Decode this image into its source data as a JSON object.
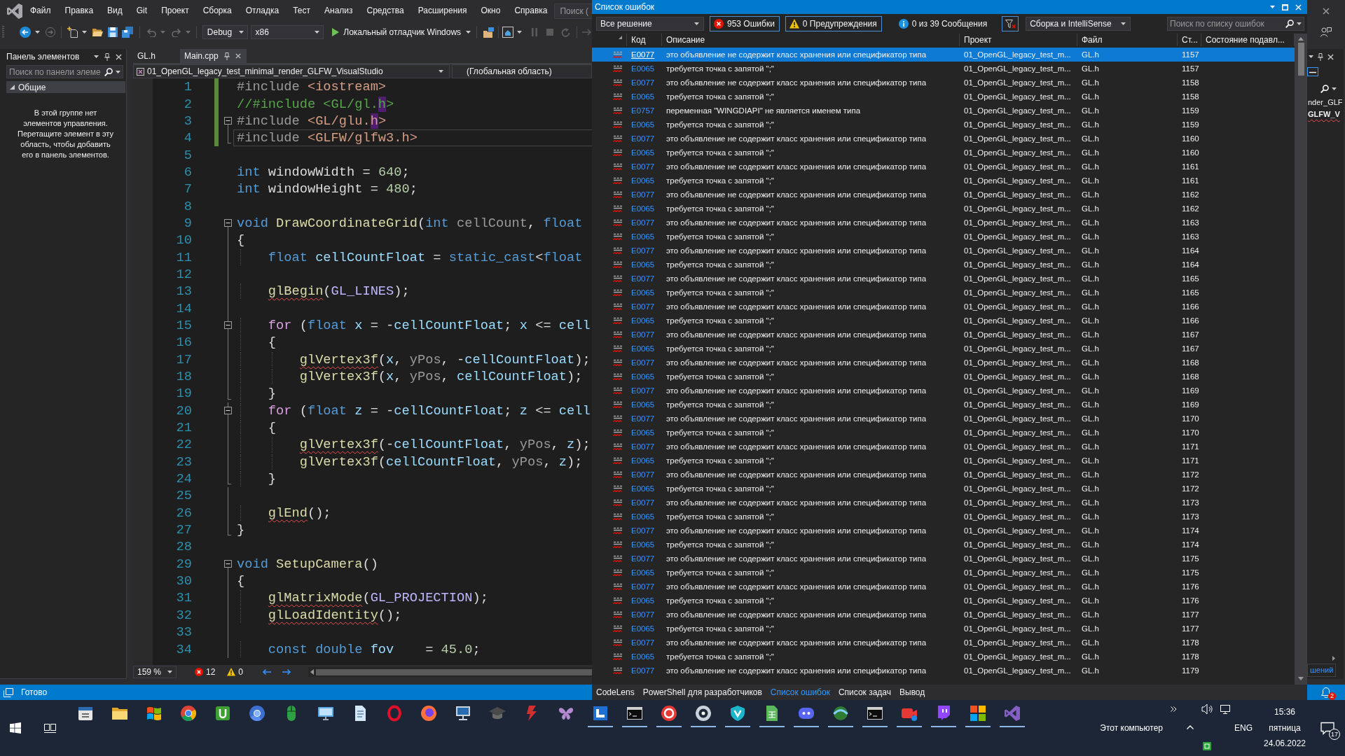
{
  "menu_bar": {
    "items": [
      "Файл",
      "Правка",
      "Вид",
      "Git",
      "Проект",
      "Сборка",
      "Отладка",
      "Тест",
      "Анализ",
      "Средства",
      "Расширения",
      "Окно",
      "Справка"
    ],
    "search": {
      "placeholder": "Поиск ("
    }
  },
  "toolbar": {
    "configuration": "Debug",
    "platform": "x86",
    "start_button": "Локальный отладчик Windows"
  },
  "toolbox": {
    "title": "Панель элементов",
    "search": {
      "placeholder": "Поиск по панели элеме"
    },
    "group": {
      "label": "Общие",
      "expanded": true
    },
    "empty_message": "В этой группе нет элементов управления. Перетащите элемент в эту область, чтобы добавить его в панель элементов."
  },
  "editor": {
    "tabs": [
      {
        "label": "GL.h",
        "selected": false
      },
      {
        "label": "Main.cpp",
        "selected": true
      }
    ],
    "project": "01_OpenGL_legacy_test_minimal_render_GLFW_VisualStudio",
    "scope": "(Глобальная область)",
    "lines": [
      {
        "number": "1",
        "kind": "plain",
        "changed": true,
        "current": false,
        "tokens": [
          {
            "text": "#include ",
            "kind": "pre"
          },
          {
            "text": "<iostream>",
            "kind": "inc"
          }
        ]
      },
      {
        "number": "2",
        "kind": "plain",
        "changed": true,
        "current": false,
        "tokens": [
          {
            "text": "//#include <GL/gl.",
            "kind": "comment"
          },
          {
            "text": "h",
            "kind": "comment_match"
          },
          {
            "text": ">",
            "kind": "comment"
          }
        ]
      },
      {
        "number": "3",
        "kind": "fold_start",
        "changed": true,
        "current": false,
        "tokens": [
          {
            "text": "#include ",
            "kind": "pre"
          },
          {
            "text": "<GL/glu.",
            "kind": "inc"
          },
          {
            "text": "h",
            "kind": "inc_match"
          },
          {
            "text": ">",
            "kind": "inc"
          }
        ]
      },
      {
        "number": "4",
        "kind": "fold_end",
        "changed": true,
        "current": true,
        "tokens": [
          {
            "text": "#include ",
            "kind": "pre"
          },
          {
            "text": "<GLFW/glfw3.h>",
            "kind": "inc"
          }
        ]
      },
      {
        "number": "5",
        "kind": "plain",
        "changed": false,
        "current": false
      },
      {
        "number": "6",
        "kind": "plain",
        "changed": false,
        "current": false,
        "tokens": [
          {
            "text": "int ",
            "kind": "kw"
          },
          {
            "text": "windowWidth = ",
            "kind": "plain"
          },
          {
            "text": "640",
            "kind": "num"
          },
          {
            "text": ";",
            "kind": "plain"
          }
        ]
      },
      {
        "number": "7",
        "kind": "plain",
        "changed": false,
        "current": false,
        "tokens": [
          {
            "text": "int ",
            "kind": "kw"
          },
          {
            "text": "windowHeight = ",
            "kind": "plain"
          },
          {
            "text": "480",
            "kind": "num"
          },
          {
            "text": ";",
            "kind": "plain"
          }
        ]
      },
      {
        "number": "8",
        "kind": "plain",
        "changed": false,
        "current": false
      },
      {
        "number": "9",
        "kind": "fold_start",
        "changed": false,
        "current": false,
        "tokens": [
          {
            "text": "void ",
            "kind": "kw"
          },
          {
            "text": "DrawCoordinateGrid",
            "kind": "fn"
          },
          {
            "text": "(",
            "kind": "plain"
          },
          {
            "text": "int ",
            "kind": "kw"
          },
          {
            "text": "cellCount",
            "kind": "param"
          },
          {
            "text": ", ",
            "kind": "plain"
          },
          {
            "text": "float",
            "kind": "kw"
          }
        ]
      },
      {
        "number": "10",
        "kind": "fold_body",
        "changed": false,
        "current": false,
        "tokens": [
          {
            "text": "{",
            "kind": "plain"
          }
        ]
      },
      {
        "number": "11",
        "kind": "fold_body",
        "changed": false,
        "current": false,
        "tokens": [
          {
            "text": "    float ",
            "kind": "kw"
          },
          {
            "text": "cellCountFloat",
            "kind": "var"
          },
          {
            "text": " = ",
            "kind": "plain"
          },
          {
            "text": "static_cast",
            "kind": "kw"
          },
          {
            "text": "<",
            "kind": "plain"
          },
          {
            "text": "float",
            "kind": "kw"
          }
        ]
      },
      {
        "number": "12",
        "kind": "fold_body",
        "changed": false,
        "current": false
      },
      {
        "number": "13",
        "kind": "fold_body",
        "changed": false,
        "current": false,
        "tokens": [
          {
            "text": "    glBegin",
            "kind": "fn_error"
          },
          {
            "text": "(",
            "kind": "plain"
          },
          {
            "text": "GL_LINES",
            "kind": "macro"
          },
          {
            "text": ");",
            "kind": "plain"
          }
        ]
      },
      {
        "number": "14",
        "kind": "fold_body",
        "changed": false,
        "current": false
      },
      {
        "number": "15",
        "kind": "fold_nested_start",
        "changed": false,
        "current": false,
        "tokens": [
          {
            "text": "    for",
            "kind": "ctrl"
          },
          {
            "text": " (",
            "kind": "plain"
          },
          {
            "text": "float ",
            "kind": "kw"
          },
          {
            "text": "x",
            "kind": "var"
          },
          {
            "text": " = -",
            "kind": "plain"
          },
          {
            "text": "cellCountFloat",
            "kind": "var"
          },
          {
            "text": "; ",
            "kind": "plain"
          },
          {
            "text": "x",
            "kind": "var"
          },
          {
            "text": " <= ",
            "kind": "plain"
          },
          {
            "text": "cell",
            "kind": "var"
          }
        ]
      },
      {
        "number": "16",
        "kind": "fold_body",
        "changed": false,
        "current": false,
        "tokens": [
          {
            "text": "    {",
            "kind": "plain"
          }
        ]
      },
      {
        "number": "17",
        "kind": "fold_body",
        "changed": false,
        "current": false,
        "tokens": [
          {
            "text": "        glVertex3f",
            "kind": "fn_error"
          },
          {
            "text": "(",
            "kind": "plain"
          },
          {
            "text": "x",
            "kind": "var"
          },
          {
            "text": ", ",
            "kind": "plain"
          },
          {
            "text": "yPos",
            "kind": "param"
          },
          {
            "text": ", -",
            "kind": "plain"
          },
          {
            "text": "cellCountFloat",
            "kind": "var"
          },
          {
            "text": ");",
            "kind": "plain"
          }
        ]
      },
      {
        "number": "18",
        "kind": "fold_body",
        "changed": false,
        "current": false,
        "tokens": [
          {
            "text": "        glVertex3f",
            "kind": "fn"
          },
          {
            "text": "(",
            "kind": "plain"
          },
          {
            "text": "x",
            "kind": "var"
          },
          {
            "text": ", ",
            "kind": "plain"
          },
          {
            "text": "yPos",
            "kind": "param"
          },
          {
            "text": ", ",
            "kind": "plain"
          },
          {
            "text": "cellCountFloat",
            "kind": "var"
          },
          {
            "text": ");",
            "kind": "plain"
          }
        ]
      },
      {
        "number": "19",
        "kind": "fold_end",
        "changed": false,
        "current": false,
        "tokens": [
          {
            "text": "    }",
            "kind": "plain"
          }
        ]
      },
      {
        "number": "20",
        "kind": "fold_nested_start",
        "changed": false,
        "current": false,
        "tokens": [
          {
            "text": "    for",
            "kind": "ctrl"
          },
          {
            "text": " (",
            "kind": "plain"
          },
          {
            "text": "float ",
            "kind": "kw"
          },
          {
            "text": "z",
            "kind": "var"
          },
          {
            "text": " = -",
            "kind": "plain"
          },
          {
            "text": "cellCountFloat",
            "kind": "var"
          },
          {
            "text": "; ",
            "kind": "plain"
          },
          {
            "text": "z",
            "kind": "var"
          },
          {
            "text": " <= ",
            "kind": "plain"
          },
          {
            "text": "cell",
            "kind": "var"
          }
        ]
      },
      {
        "number": "21",
        "kind": "fold_body",
        "changed": false,
        "current": false,
        "tokens": [
          {
            "text": "    {",
            "kind": "plain"
          }
        ]
      },
      {
        "number": "22",
        "kind": "fold_body",
        "changed": false,
        "current": false,
        "tokens": [
          {
            "text": "        glVertex3f",
            "kind": "fn_error"
          },
          {
            "text": "(-",
            "kind": "plain"
          },
          {
            "text": "cellCountFloat",
            "kind": "var"
          },
          {
            "text": ", ",
            "kind": "plain"
          },
          {
            "text": "yPos",
            "kind": "param"
          },
          {
            "text": ", ",
            "kind": "plain"
          },
          {
            "text": "z",
            "kind": "var"
          },
          {
            "text": ");",
            "kind": "plain"
          }
        ]
      },
      {
        "number": "23",
        "kind": "fold_body",
        "changed": false,
        "current": false,
        "tokens": [
          {
            "text": "        glVertex3f",
            "kind": "fn"
          },
          {
            "text": "(",
            "kind": "plain"
          },
          {
            "text": "cellCountFloat",
            "kind": "var"
          },
          {
            "text": ", ",
            "kind": "plain"
          },
          {
            "text": "yPos",
            "kind": "param"
          },
          {
            "text": ", ",
            "kind": "plain"
          },
          {
            "text": "z",
            "kind": "var"
          },
          {
            "text": ");",
            "kind": "plain"
          }
        ]
      },
      {
        "number": "24",
        "kind": "fold_end",
        "changed": false,
        "current": false,
        "tokens": [
          {
            "text": "    }",
            "kind": "plain"
          }
        ]
      },
      {
        "number": "25",
        "kind": "fold_body",
        "changed": false,
        "current": false
      },
      {
        "number": "26",
        "kind": "fold_body",
        "changed": false,
        "current": false,
        "tokens": [
          {
            "text": "    glEnd",
            "kind": "fn_error"
          },
          {
            "text": "();",
            "kind": "plain"
          }
        ]
      },
      {
        "number": "27",
        "kind": "fold_end",
        "changed": false,
        "current": false,
        "tokens": [
          {
            "text": "}",
            "kind": "plain"
          }
        ]
      },
      {
        "number": "28",
        "kind": "plain",
        "changed": false,
        "current": false
      },
      {
        "number": "29",
        "kind": "fold_start",
        "changed": false,
        "current": false,
        "tokens": [
          {
            "text": "void ",
            "kind": "kw"
          },
          {
            "text": "SetupCamera",
            "kind": "fn"
          },
          {
            "text": "()",
            "kind": "plain"
          }
        ]
      },
      {
        "number": "30",
        "kind": "fold_body",
        "changed": false,
        "current": false,
        "tokens": [
          {
            "text": "{",
            "kind": "plain"
          }
        ]
      },
      {
        "number": "31",
        "kind": "fold_body",
        "changed": false,
        "current": false,
        "tokens": [
          {
            "text": "    glMatrixMode",
            "kind": "fn_error"
          },
          {
            "text": "(",
            "kind": "plain"
          },
          {
            "text": "GL_PROJECTION",
            "kind": "macro"
          },
          {
            "text": ");",
            "kind": "plain"
          }
        ]
      },
      {
        "number": "32",
        "kind": "fold_body",
        "changed": false,
        "current": false,
        "tokens": [
          {
            "text": "    glLoadIdentity",
            "kind": "fn_error"
          },
          {
            "text": "();",
            "kind": "plain"
          }
        ]
      },
      {
        "number": "33",
        "kind": "fold_body",
        "changed": false,
        "current": false
      },
      {
        "number": "34",
        "kind": "fold_body",
        "changed": false,
        "current": false,
        "tokens": [
          {
            "text": "    const ",
            "kind": "kw"
          },
          {
            "text": "double ",
            "kind": "kw"
          },
          {
            "text": "fov",
            "kind": "var"
          },
          {
            "text": "    = ",
            "kind": "plain"
          },
          {
            "text": "45.0",
            "kind": "num"
          },
          {
            "text": ";",
            "kind": "plain"
          }
        ]
      }
    ],
    "zoom": "159 %",
    "errors": "12",
    "warnings": "0"
  },
  "status_bar": {
    "text": "Готово"
  },
  "error_list": {
    "title": "Список ошибок",
    "scope": "Все решение",
    "filters": [
      {
        "kind": "error",
        "label": "953 Ошибки",
        "selected": true
      },
      {
        "kind": "warning",
        "label": "0 Предупреждения",
        "selected": true
      },
      {
        "kind": "info",
        "label": "0 из 39 Сообщения",
        "selected": false
      }
    ],
    "filter_button": {
      "selected": true
    },
    "source": "Сборка и IntelliSense",
    "search": {
      "placeholder": "Поиск по списку ошибок"
    },
    "columns": [
      "Код",
      "Описание",
      "Проект",
      "Файл",
      "Ст...",
      "Состояние подавл..."
    ],
    "rows": [
      {
        "code": "E0077",
        "description": "это объявление не содержит класс хранения или спецификатор типа",
        "project": "01_OpenGL_legacy_test_m...",
        "file": "GL.h",
        "line": "1157",
        "selected": true
      },
      {
        "code": "E0065",
        "description": "требуется точка с запятой \";\"",
        "project": "01_OpenGL_legacy_test_m...",
        "file": "GL.h",
        "line": "1157",
        "selected": false
      },
      {
        "code": "E0077",
        "description": "это объявление не содержит класс хранения или спецификатор типа",
        "project": "01_OpenGL_legacy_test_m...",
        "file": "GL.h",
        "line": "1158",
        "selected": false
      },
      {
        "code": "E0065",
        "description": "требуется точка с запятой \";\"",
        "project": "01_OpenGL_legacy_test_m...",
        "file": "GL.h",
        "line": "1158",
        "selected": false
      },
      {
        "code": "E0757",
        "description": "переменная \"WINGDIAPI\" не является именем типа",
        "project": "01_OpenGL_legacy_test_m...",
        "file": "GL.h",
        "line": "1159",
        "selected": false
      },
      {
        "code": "E0065",
        "description": "требуется точка с запятой \";\"",
        "project": "01_OpenGL_legacy_test_m...",
        "file": "GL.h",
        "line": "1159",
        "selected": false
      },
      {
        "code": "E0077",
        "description": "это объявление не содержит класс хранения или спецификатор типа",
        "project": "01_OpenGL_legacy_test_m...",
        "file": "GL.h",
        "line": "1160",
        "selected": false
      },
      {
        "code": "E0065",
        "description": "требуется точка с запятой \";\"",
        "project": "01_OpenGL_legacy_test_m...",
        "file": "GL.h",
        "line": "1160",
        "selected": false
      },
      {
        "code": "E0077",
        "description": "это объявление не содержит класс хранения или спецификатор типа",
        "project": "01_OpenGL_legacy_test_m...",
        "file": "GL.h",
        "line": "1161",
        "selected": false
      },
      {
        "code": "E0065",
        "description": "требуется точка с запятой \";\"",
        "project": "01_OpenGL_legacy_test_m...",
        "file": "GL.h",
        "line": "1161",
        "selected": false
      },
      {
        "code": "E0077",
        "description": "это объявление не содержит класс хранения или спецификатор типа",
        "project": "01_OpenGL_legacy_test_m...",
        "file": "GL.h",
        "line": "1162",
        "selected": false
      },
      {
        "code": "E0065",
        "description": "требуется точка с запятой \";\"",
        "project": "01_OpenGL_legacy_test_m...",
        "file": "GL.h",
        "line": "1162",
        "selected": false
      },
      {
        "code": "E0077",
        "description": "это объявление не содержит класс хранения или спецификатор типа",
        "project": "01_OpenGL_legacy_test_m...",
        "file": "GL.h",
        "line": "1163",
        "selected": false
      },
      {
        "code": "E0065",
        "description": "требуется точка с запятой \";\"",
        "project": "01_OpenGL_legacy_test_m...",
        "file": "GL.h",
        "line": "1163",
        "selected": false
      },
      {
        "code": "E0077",
        "description": "это объявление не содержит класс хранения или спецификатор типа",
        "project": "01_OpenGL_legacy_test_m...",
        "file": "GL.h",
        "line": "1164",
        "selected": false
      },
      {
        "code": "E0065",
        "description": "требуется точка с запятой \";\"",
        "project": "01_OpenGL_legacy_test_m...",
        "file": "GL.h",
        "line": "1164",
        "selected": false
      },
      {
        "code": "E0077",
        "description": "это объявление не содержит класс хранения или спецификатор типа",
        "project": "01_OpenGL_legacy_test_m...",
        "file": "GL.h",
        "line": "1165",
        "selected": false
      },
      {
        "code": "E0065",
        "description": "требуется точка с запятой \";\"",
        "project": "01_OpenGL_legacy_test_m...",
        "file": "GL.h",
        "line": "1165",
        "selected": false
      },
      {
        "code": "E0077",
        "description": "это объявление не содержит класс хранения или спецификатор типа",
        "project": "01_OpenGL_legacy_test_m...",
        "file": "GL.h",
        "line": "1166",
        "selected": false
      },
      {
        "code": "E0065",
        "description": "требуется точка с запятой \";\"",
        "project": "01_OpenGL_legacy_test_m...",
        "file": "GL.h",
        "line": "1166",
        "selected": false
      },
      {
        "code": "E0077",
        "description": "это объявление не содержит класс хранения или спецификатор типа",
        "project": "01_OpenGL_legacy_test_m...",
        "file": "GL.h",
        "line": "1167",
        "selected": false
      },
      {
        "code": "E0065",
        "description": "требуется точка с запятой \";\"",
        "project": "01_OpenGL_legacy_test_m...",
        "file": "GL.h",
        "line": "1167",
        "selected": false
      },
      {
        "code": "E0077",
        "description": "это объявление не содержит класс хранения или спецификатор типа",
        "project": "01_OpenGL_legacy_test_m...",
        "file": "GL.h",
        "line": "1168",
        "selected": false
      },
      {
        "code": "E0065",
        "description": "требуется точка с запятой \";\"",
        "project": "01_OpenGL_legacy_test_m...",
        "file": "GL.h",
        "line": "1168",
        "selected": false
      },
      {
        "code": "E0077",
        "description": "это объявление не содержит класс хранения или спецификатор типа",
        "project": "01_OpenGL_legacy_test_m...",
        "file": "GL.h",
        "line": "1169",
        "selected": false
      },
      {
        "code": "E0065",
        "description": "требуется точка с запятой \";\"",
        "project": "01_OpenGL_legacy_test_m...",
        "file": "GL.h",
        "line": "1169",
        "selected": false
      },
      {
        "code": "E0077",
        "description": "это объявление не содержит класс хранения или спецификатор типа",
        "project": "01_OpenGL_legacy_test_m...",
        "file": "GL.h",
        "line": "1170",
        "selected": false
      },
      {
        "code": "E0065",
        "description": "требуется точка с запятой \";\"",
        "project": "01_OpenGL_legacy_test_m...",
        "file": "GL.h",
        "line": "1170",
        "selected": false
      },
      {
        "code": "E0077",
        "description": "это объявление не содержит класс хранения или спецификатор типа",
        "project": "01_OpenGL_legacy_test_m...",
        "file": "GL.h",
        "line": "1171",
        "selected": false
      },
      {
        "code": "E0065",
        "description": "требуется точка с запятой \";\"",
        "project": "01_OpenGL_legacy_test_m...",
        "file": "GL.h",
        "line": "1171",
        "selected": false
      },
      {
        "code": "E0077",
        "description": "это объявление не содержит класс хранения или спецификатор типа",
        "project": "01_OpenGL_legacy_test_m...",
        "file": "GL.h",
        "line": "1172",
        "selected": false
      },
      {
        "code": "E0065",
        "description": "требуется точка с запятой \";\"",
        "project": "01_OpenGL_legacy_test_m...",
        "file": "GL.h",
        "line": "1172",
        "selected": false
      },
      {
        "code": "E0077",
        "description": "это объявление не содержит класс хранения или спецификатор типа",
        "project": "01_OpenGL_legacy_test_m...",
        "file": "GL.h",
        "line": "1173",
        "selected": false
      },
      {
        "code": "E0065",
        "description": "требуется точка с запятой \";\"",
        "project": "01_OpenGL_legacy_test_m...",
        "file": "GL.h",
        "line": "1173",
        "selected": false
      },
      {
        "code": "E0077",
        "description": "это объявление не содержит класс хранения или спецификатор типа",
        "project": "01_OpenGL_legacy_test_m...",
        "file": "GL.h",
        "line": "1174",
        "selected": false
      },
      {
        "code": "E0065",
        "description": "требуется точка с запятой \";\"",
        "project": "01_OpenGL_legacy_test_m...",
        "file": "GL.h",
        "line": "1174",
        "selected": false
      },
      {
        "code": "E0077",
        "description": "это объявление не содержит класс хранения или спецификатор типа",
        "project": "01_OpenGL_legacy_test_m...",
        "file": "GL.h",
        "line": "1175",
        "selected": false
      },
      {
        "code": "E0065",
        "description": "требуется точка с запятой \";\"",
        "project": "01_OpenGL_legacy_test_m...",
        "file": "GL.h",
        "line": "1175",
        "selected": false
      },
      {
        "code": "E0077",
        "description": "это объявление не содержит класс хранения или спецификатор типа",
        "project": "01_OpenGL_legacy_test_m...",
        "file": "GL.h",
        "line": "1176",
        "selected": false
      },
      {
        "code": "E0065",
        "description": "требуется точка с запятой \";\"",
        "project": "01_OpenGL_legacy_test_m...",
        "file": "GL.h",
        "line": "1176",
        "selected": false
      },
      {
        "code": "E0077",
        "description": "это объявление не содержит класс хранения или спецификатор типа",
        "project": "01_OpenGL_legacy_test_m...",
        "file": "GL.h",
        "line": "1177",
        "selected": false
      },
      {
        "code": "E0065",
        "description": "требуется точка с запятой \";\"",
        "project": "01_OpenGL_legacy_test_m...",
        "file": "GL.h",
        "line": "1177",
        "selected": false
      },
      {
        "code": "E0077",
        "description": "это объявление не содержит класс хранения или спецификатор типа",
        "project": "01_OpenGL_legacy_test_m...",
        "file": "GL.h",
        "line": "1178",
        "selected": false
      },
      {
        "code": "E0065",
        "description": "требуется точка с запятой \";\"",
        "project": "01_OpenGL_legacy_test_m...",
        "file": "GL.h",
        "line": "1178",
        "selected": false
      },
      {
        "code": "E0077",
        "description": "это объявление не содержит класс хранения или спецификатор типа",
        "project": "01_OpenGL_legacy_test_m...",
        "file": "GL.h",
        "line": "1179",
        "selected": false
      }
    ],
    "tabs": [
      {
        "label": "CodeLens",
        "selected": false
      },
      {
        "label": "PowerShell для разработчиков",
        "selected": false
      },
      {
        "label": "Список ошибок",
        "selected": true
      },
      {
        "label": "Список задач",
        "selected": false
      },
      {
        "label": "Вывод",
        "selected": false
      }
    ]
  },
  "side_panel": {
    "tree_items": [
      {
        "label": "nder_GLF",
        "startup": false,
        "has_errors": false
      },
      {
        "label": "GLFW_V",
        "startup": true,
        "has_errors": true
      }
    ],
    "tabs": [
      {
        "label": "шений",
        "selected": true
      }
    ],
    "notifications": "2"
  },
  "taskbar": {
    "apps": [
      {
        "kind": "calendar",
        "running": false
      },
      {
        "kind": "folder",
        "running": false
      },
      {
        "kind": "flag",
        "running": false
      },
      {
        "kind": "tricolor_circle",
        "running": false
      },
      {
        "kind": "green_tile",
        "running": false
      },
      {
        "kind": "blue_circle",
        "running": false
      },
      {
        "kind": "mouse",
        "running": false
      },
      {
        "kind": "monitor",
        "running": false
      },
      {
        "kind": "notepad",
        "running": false
      },
      {
        "kind": "ring",
        "running": false
      },
      {
        "kind": "flame_circle",
        "running": false
      },
      {
        "kind": "computer",
        "running": false
      },
      {
        "kind": "hat",
        "running": false
      },
      {
        "kind": "bolt",
        "running": false
      },
      {
        "kind": "butterfly",
        "running": false
      },
      {
        "kind": "blue_tile",
        "running": true
      },
      {
        "kind": "terminal",
        "running": true
      },
      {
        "kind": "disc",
        "running": true
      },
      {
        "kind": "eye",
        "running": true
      },
      {
        "kind": "shield",
        "running": true
      },
      {
        "kind": "sheet",
        "running": true
      },
      {
        "kind": "controller",
        "running": true
      },
      {
        "kind": "globe",
        "running": true
      },
      {
        "kind": "terminal",
        "running": true
      },
      {
        "kind": "camera",
        "running": true
      },
      {
        "kind": "chat",
        "running": true
      },
      {
        "kind": "tiles",
        "running": true
      },
      {
        "kind": "ribbon",
        "running": true
      }
    ],
    "toolbar_label": "Этот компьютер",
    "language": "ENG",
    "time": "15:36",
    "weekday": "пятница",
    "date": "24.06.2022",
    "notifications": "17"
  }
}
